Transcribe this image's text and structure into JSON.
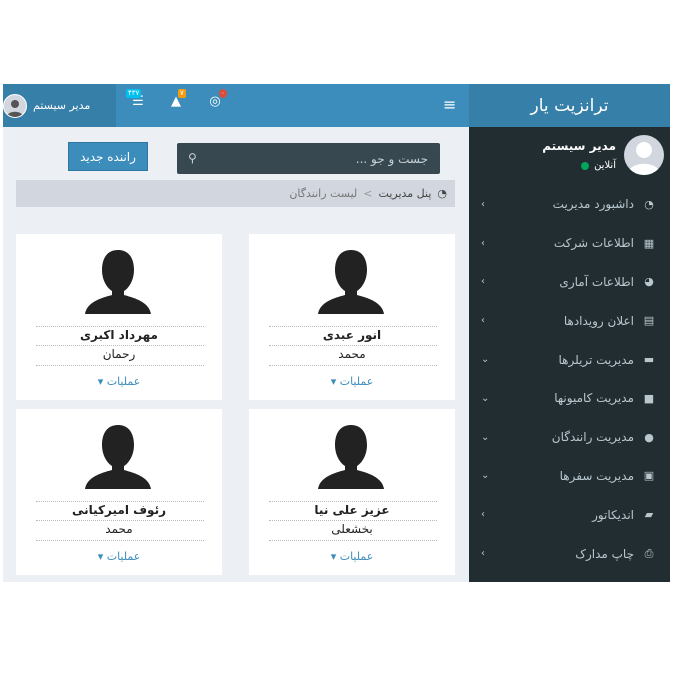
{
  "app": {
    "title": "ترانزیت یار"
  },
  "topbar": {
    "user_name": "مدیر سیستم",
    "badges": {
      "tasks": "۴۳۷",
      "alerts": "۷",
      "messages": "۰"
    }
  },
  "sidebar": {
    "user": {
      "name": "مدیر سیستم",
      "status": "آنلاین"
    },
    "items": [
      {
        "label": "داشبورد مدیریت",
        "icon": "dashboard-icon",
        "glyph": "◔",
        "chevron": "›"
      },
      {
        "label": "اطلاعات شرکت",
        "icon": "building-icon",
        "glyph": "▦",
        "chevron": "›"
      },
      {
        "label": "اطلاعات آماری",
        "icon": "pie-chart-icon",
        "glyph": "◕",
        "chevron": "›"
      },
      {
        "label": "اعلان رویدادها",
        "icon": "calendar-icon",
        "glyph": "▤",
        "chevron": "›"
      },
      {
        "label": "مدیریت تریلرها",
        "icon": "trailer-icon",
        "glyph": "▬",
        "chevron": "⌄"
      },
      {
        "label": "مدیریت کامیونها",
        "icon": "truck-icon",
        "glyph": "■",
        "chevron": "⌄"
      },
      {
        "label": "مدیریت رانندگان",
        "icon": "user-icon",
        "glyph": "●",
        "chevron": "⌄"
      },
      {
        "label": "مدیریت سفرها",
        "icon": "bus-icon",
        "glyph": "▣",
        "chevron": "⌄"
      },
      {
        "label": "اندیکاتور",
        "icon": "folder-icon",
        "glyph": "▰",
        "chevron": "›"
      },
      {
        "label": "چاپ مدارک",
        "icon": "print-icon",
        "glyph": "⎙",
        "chevron": "›"
      }
    ]
  },
  "search": {
    "placeholder": "جست و جو ..."
  },
  "actions": {
    "new_driver": "راننده جدید"
  },
  "breadcrumb": {
    "root": "پنل مدیریت",
    "separator": ">",
    "current": "لیست رانندگان"
  },
  "drivers": [
    {
      "name": "انور عبدی",
      "sub": "محمد",
      "ops": "عملیات"
    },
    {
      "name": "مهرداد اکبری",
      "sub": "رحمان",
      "ops": "عملیات"
    },
    {
      "name": "عزیز علی نیا",
      "sub": "بخشعلی",
      "ops": "عملیات"
    },
    {
      "name": "رئوف امیرکیانی",
      "sub": "محمد",
      "ops": "عملیات"
    }
  ],
  "colors": {
    "primary": "#3c8dbc",
    "primary_dark": "#367fa9",
    "sidebar": "#222d32",
    "online": "#00a65a"
  }
}
